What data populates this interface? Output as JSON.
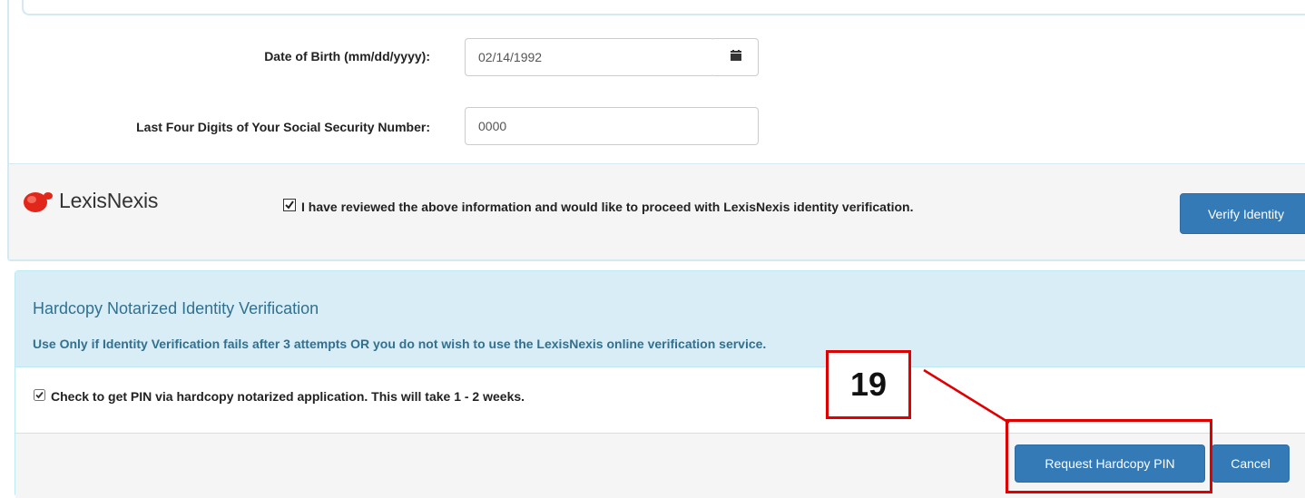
{
  "form": {
    "dob_label": "Date of Birth (mm/dd/yyyy):",
    "dob_value": "02/14/1992",
    "ssn_label": "Last Four Digits of Your Social Security Number:",
    "ssn_value": "0000"
  },
  "lexis": {
    "brand": "LexisNexis",
    "review_text": "I have reviewed the above information and would like to proceed with LexisNexis identity verification.",
    "verify_button": "Verify Identity"
  },
  "hardcopy": {
    "title": "Hardcopy Notarized Identity Verification",
    "subtitle": "Use Only if Identity Verification fails after 3 attempts OR you do not wish to use the LexisNexis online verification service.",
    "pin_checkbox_label": "Check to get PIN via hardcopy notarized application. This will take 1 - 2 weeks.",
    "request_button": "Request Hardcopy PIN",
    "cancel_button": "Cancel"
  },
  "annotation": {
    "step_number": "19"
  },
  "colors": {
    "primary": "#337ab7",
    "info_bg": "#d9edf7",
    "info_text": "#31708f",
    "annotation_red": "#e00000",
    "lexis_red": "#e1261c"
  },
  "icons": {
    "calendar": "calendar-icon",
    "checkbox": "checkbox-checked-icon"
  }
}
